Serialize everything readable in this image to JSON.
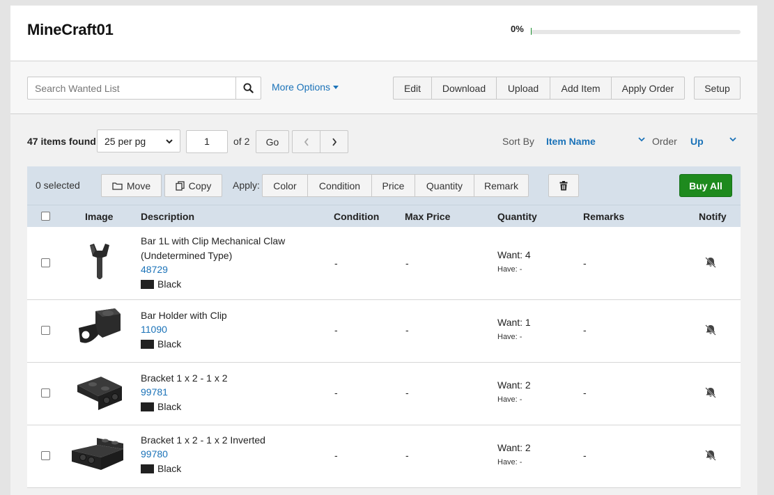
{
  "header": {
    "title": "MineCraft01",
    "progress_text": "0%",
    "progress_fraction": 0.0
  },
  "toolbar": {
    "search_placeholder": "Search Wanted List",
    "more_options": "More Options",
    "buttons": [
      "Edit",
      "Download",
      "Upload",
      "Add Item",
      "Apply Order"
    ],
    "setup": "Setup"
  },
  "pager": {
    "items_found": "47 items found",
    "per_page": "25 per pg",
    "page": "1",
    "of_pages": "of 2",
    "go": "Go",
    "sort_label": "Sort By",
    "sort_value": "Item Name",
    "order_label": "Order",
    "order_value": "Up"
  },
  "action_bar": {
    "selected": "0 selected",
    "move": "Move",
    "copy": "Copy",
    "apply_label": "Apply:",
    "apply_buttons": [
      "Color",
      "Condition",
      "Price",
      "Quantity",
      "Remark"
    ],
    "buy_all": "Buy All"
  },
  "table": {
    "headers": {
      "image": "Image",
      "description": "Description",
      "condition": "Condition",
      "max_price": "Max Price",
      "quantity": "Quantity",
      "remarks": "Remarks",
      "notify": "Notify"
    },
    "rows": [
      {
        "name": "Bar 1L with Clip Mechanical Claw (Undetermined Type)",
        "part_id": "48729",
        "color": "Black",
        "condition": "-",
        "max_price": "-",
        "want": "Want: 4",
        "have": "Have: -",
        "remarks": "-"
      },
      {
        "name": "Bar Holder with Clip",
        "part_id": "11090",
        "color": "Black",
        "condition": "-",
        "max_price": "-",
        "want": "Want: 1",
        "have": "Have: -",
        "remarks": "-"
      },
      {
        "name": "Bracket 1 x 2 - 1 x 2",
        "part_id": "99781",
        "color": "Black",
        "condition": "-",
        "max_price": "-",
        "want": "Want: 2",
        "have": "Have: -",
        "remarks": "-"
      },
      {
        "name": "Bracket 1 x 2 - 1 x 2 Inverted",
        "part_id": "99780",
        "color": "Black",
        "condition": "-",
        "max_price": "-",
        "want": "Want: 2",
        "have": "Have: -",
        "remarks": "-"
      }
    ]
  },
  "colors": {
    "accent": "#1a72b8",
    "buy_green": "#1e8a1e",
    "header_band": "#d6e0ea",
    "swatch_black": "#212121"
  },
  "icons": [
    "search-icon",
    "caret-down-icon",
    "chevron-left-icon",
    "chevron-right-icon",
    "chevron-down-icon",
    "folder-icon",
    "copy-icon",
    "trash-icon",
    "bell-off-icon"
  ]
}
